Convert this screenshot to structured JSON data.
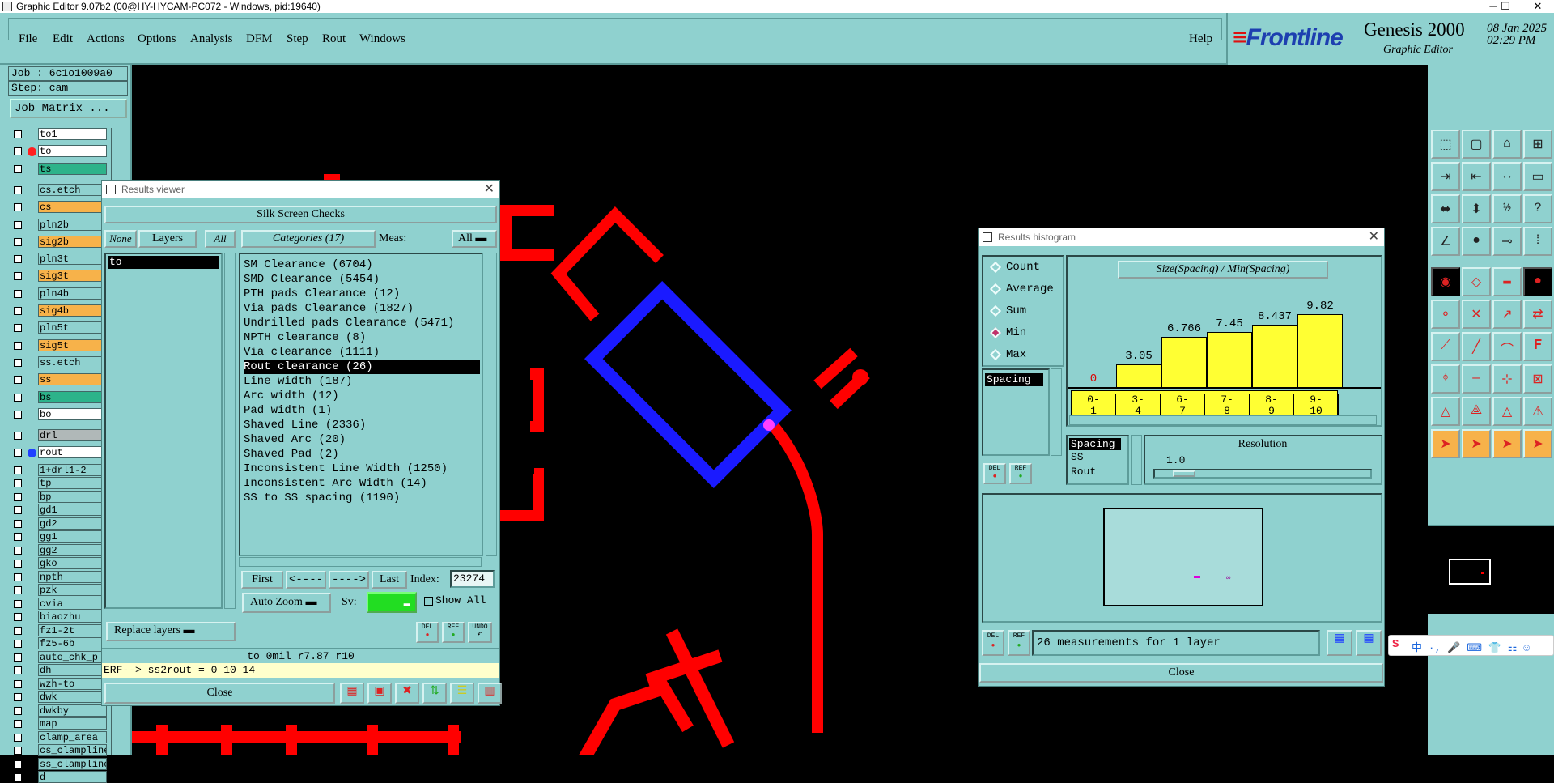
{
  "window": {
    "title": "Graphic Editor 9.07b2 (00@HY-HYCAM-PC072 - Windows, pid:19640)",
    "min": "─",
    "max": "☐",
    "close": "✕"
  },
  "menu": [
    "File",
    "Edit",
    "Actions",
    "Options",
    "Analysis",
    "DFM",
    "Step",
    "Rout",
    "Windows"
  ],
  "help": "Help",
  "brand": {
    "logo": "Frontline",
    "product": "Genesis 2000",
    "subtitle": "Graphic Editor",
    "date": "08 Jan 2025",
    "time": "02:29 PM"
  },
  "left": {
    "job": "Job : 6c1o1009a0",
    "step": "Step: cam",
    "job_matrix": "Job Matrix ...",
    "layers": [
      {
        "name": "to1",
        "color": "#ffffff"
      },
      {
        "name": "to",
        "color": "#ffffff",
        "dot": "#ff2020",
        "marker": true
      },
      {
        "name": "ts",
        "color": "#2db38a"
      },
      {
        "name": "cs.etch",
        "color": "#8fd1cf"
      },
      {
        "name": "cs",
        "color": "#f7b24a"
      },
      {
        "name": "pln2b",
        "color": "#8fd1cf"
      },
      {
        "name": "sig2b",
        "color": "#f7b24a"
      },
      {
        "name": "pln3t",
        "color": "#8fd1cf"
      },
      {
        "name": "sig3t",
        "color": "#f7b24a"
      },
      {
        "name": "pln4b",
        "color": "#8fd1cf"
      },
      {
        "name": "sig4b",
        "color": "#f7b24a"
      },
      {
        "name": "pln5t",
        "color": "#8fd1cf"
      },
      {
        "name": "sig5t",
        "color": "#f7b24a"
      },
      {
        "name": "ss.etch",
        "color": "#8fd1cf"
      },
      {
        "name": "ss",
        "color": "#f7b24a"
      },
      {
        "name": "bs",
        "color": "#2db38a"
      },
      {
        "name": "bo",
        "color": "#ffffff"
      },
      {
        "name": "drl",
        "color": "#b0b8b8"
      },
      {
        "name": "rout",
        "color": "#ffffff",
        "dot": "#2040ff"
      },
      {
        "name": "1+drl1-2",
        "color": "#8fd1cf"
      },
      {
        "name": "tp",
        "color": "#8fd1cf"
      },
      {
        "name": "bp",
        "color": "#8fd1cf"
      },
      {
        "name": "gd1",
        "color": "#8fd1cf"
      },
      {
        "name": "gd2",
        "color": "#8fd1cf"
      },
      {
        "name": "gg1",
        "color": "#8fd1cf"
      },
      {
        "name": "gg2",
        "color": "#8fd1cf"
      },
      {
        "name": "gko",
        "color": "#8fd1cf"
      },
      {
        "name": "npth",
        "color": "#8fd1cf"
      },
      {
        "name": "pzk",
        "color": "#8fd1cf"
      },
      {
        "name": "cvia",
        "color": "#8fd1cf"
      },
      {
        "name": "biaozhu",
        "color": "#8fd1cf"
      },
      {
        "name": "fz1-2t",
        "color": "#8fd1cf"
      },
      {
        "name": "fz5-6b",
        "color": "#8fd1cf"
      },
      {
        "name": "auto_chk_p",
        "color": "#8fd1cf"
      },
      {
        "name": "dh",
        "color": "#8fd1cf"
      },
      {
        "name": "wzh-to",
        "color": "#8fd1cf"
      },
      {
        "name": "dwk",
        "color": "#8fd1cf"
      },
      {
        "name": "dwkby",
        "color": "#8fd1cf"
      },
      {
        "name": "map",
        "color": "#8fd1cf"
      },
      {
        "name": "clamp_area",
        "color": "#8fd1cf"
      },
      {
        "name": "cs_clampline",
        "color": "#8fd1cf"
      },
      {
        "name": "ss_clampline",
        "color": "#8fd1cf"
      },
      {
        "name": "d",
        "color": "#8fd1cf"
      }
    ]
  },
  "results_viewer": {
    "title": "Results viewer",
    "header": "Silk Screen Checks",
    "none": "None",
    "layers": "Layers",
    "all": "All",
    "categories_label": "Categories (17)",
    "meas_label": "Meas:",
    "meas_value": "All",
    "layer_list": [
      "to"
    ],
    "categories": [
      "SM Clearance (6704)",
      "SMD Clearance (5454)",
      "PTH pads Clearance (12)",
      "Via pads Clearance (1827)",
      "Undrilled pads Clearance (5471)",
      "NPTH clearance (8)",
      "Via clearance (1111)",
      "Rout clearance (26)",
      "Line width (187)",
      "Arc width (12)",
      "Pad width (1)",
      "Shaved Line (2336)",
      "Shaved Arc (20)",
      "Shaved Pad (2)",
      "Inconsistent Line Width (1250)",
      "Inconsistent Arc Width (14)",
      "SS to SS spacing (1190)"
    ],
    "selected_index": 7,
    "first": "First",
    "prev": "<----",
    "next": "---->",
    "last": "Last",
    "index_label": "Index:",
    "index_value": "23274",
    "auto_zoom": "Auto Zoom",
    "sv_label": "Sv:",
    "show_all": "Show All",
    "del": "DEL",
    "ref": "REF",
    "undo": "UNDO",
    "replace_layers": "Replace layers",
    "status": "to 0mil  r7.87  r10",
    "erf": "ERF--> ss2rout = 0 10 14",
    "close": "Close"
  },
  "histogram": {
    "title": "Results histogram",
    "modes": [
      {
        "label": "Count",
        "on": false
      },
      {
        "label": "Average",
        "on": false
      },
      {
        "label": "Sum",
        "on": false
      },
      {
        "label": "Min",
        "on": true
      },
      {
        "label": "Max",
        "on": false
      }
    ],
    "chart_title": "Size(Spacing) / Min(Spacing)",
    "list_item": "Spacing",
    "side_list": [
      "Spacing",
      "SS",
      "Rout"
    ],
    "resolution_label": "Resolution",
    "resolution_value": "1.0",
    "summary": "26 measurements for 1 layer",
    "del": "DEL",
    "ref": "REF",
    "close": "Close"
  },
  "chart_data": {
    "type": "bar",
    "title": "Size(Spacing) / Min(Spacing)",
    "categories": [
      "0-1",
      "3-4",
      "6-7",
      "7-8",
      "8-9",
      "9-10"
    ],
    "values": [
      0,
      3.05,
      6.766,
      7.45,
      8.437,
      9.82
    ],
    "labels": [
      "0",
      "3.05",
      "6.766",
      "7.45",
      "8.437",
      "9.82"
    ],
    "ylim": [
      0,
      9.82
    ]
  },
  "canvas": {
    "colors": {
      "red": "#ff0000",
      "blue": "#1a1aff",
      "magenta": "#ff40ff"
    }
  }
}
